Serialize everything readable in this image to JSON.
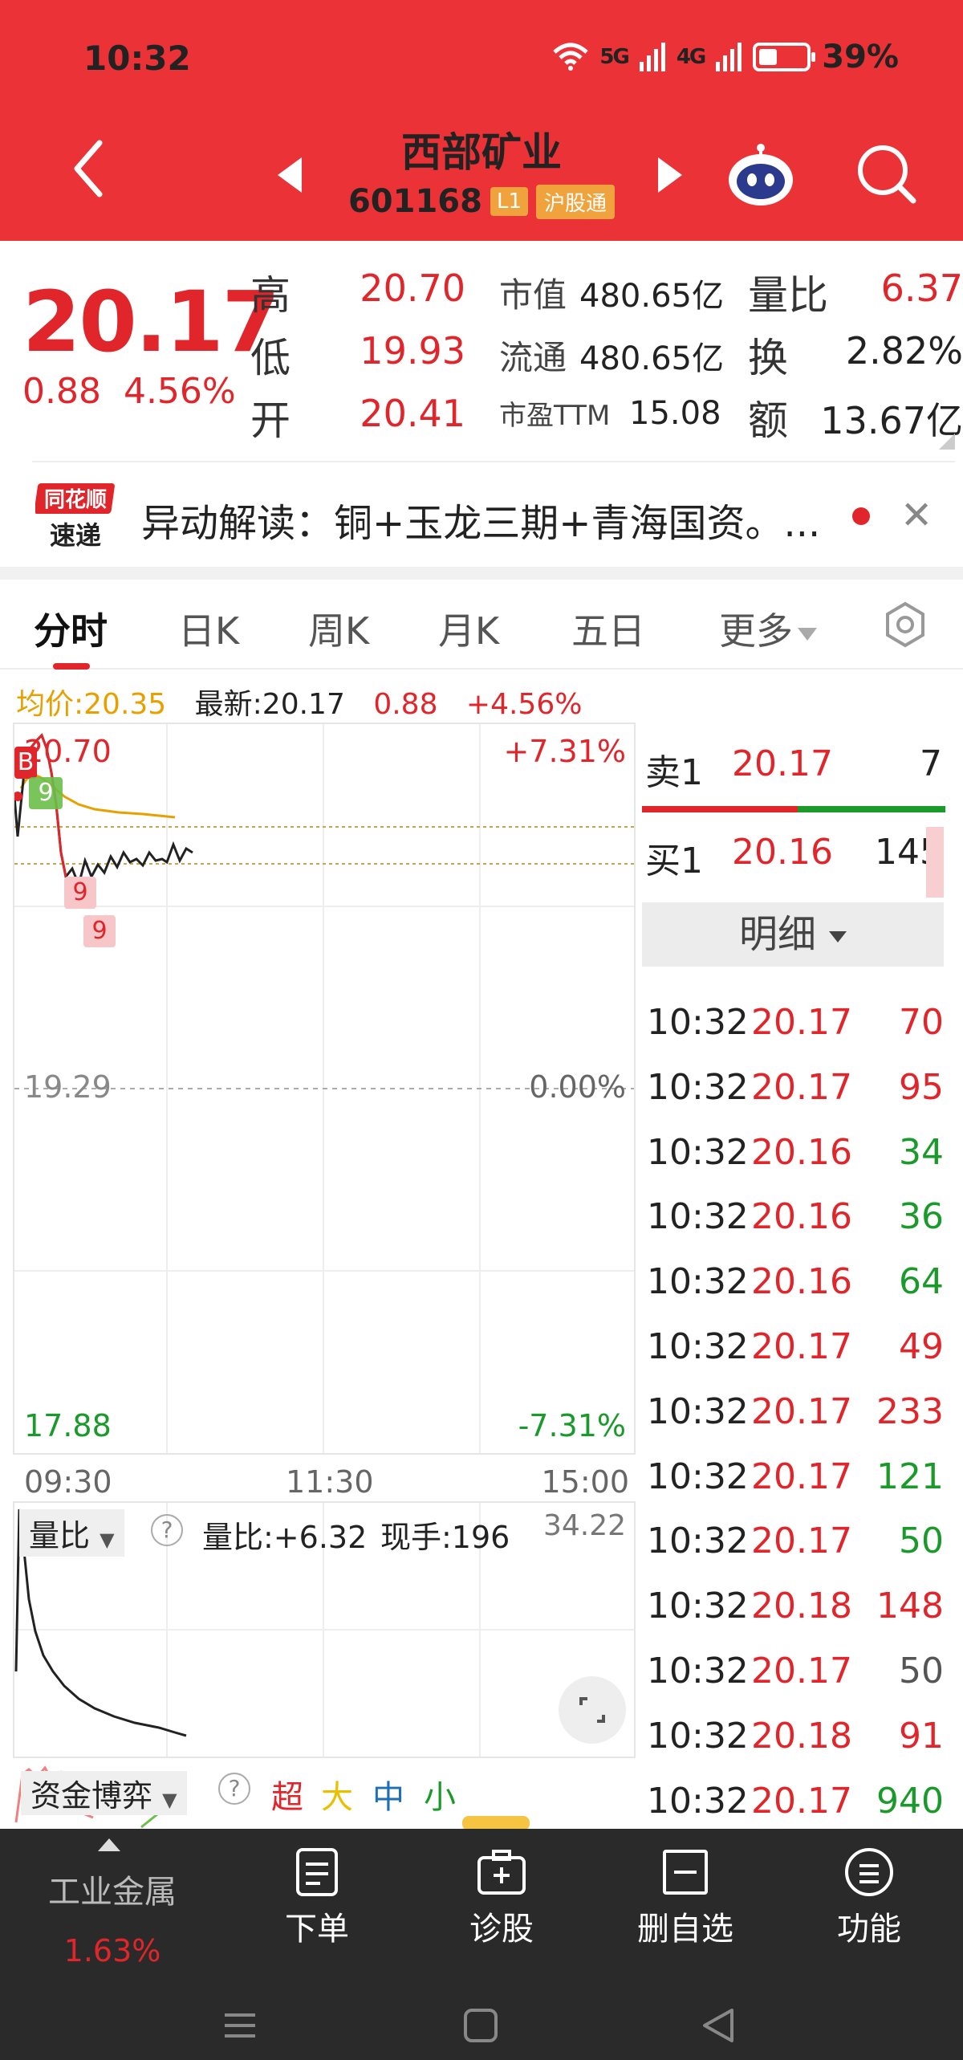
{
  "status_bar": {
    "time": "10:32",
    "signal1": "5G",
    "signal2": "4G",
    "battery": "39%"
  },
  "header": {
    "title": "西部矿业",
    "code": "601168",
    "level_tag": "L1",
    "connect_tag": "沪股通"
  },
  "quote": {
    "price": "20.17",
    "change": "0.88",
    "change_pct": "4.56%",
    "high_label": "高",
    "high": "20.70",
    "low_label": "低",
    "low": "19.93",
    "open_label": "开",
    "open": "20.41",
    "mcap_label": "市值",
    "mcap": "480.65亿",
    "float_label": "流通",
    "float": "480.65亿",
    "pe_label": "市盈TTM",
    "pe": "15.08",
    "vr_label": "量比",
    "vr": "6.37",
    "turnover_label": "换",
    "turnover": "2.82%",
    "amount_label": "额",
    "amount": "13.67亿"
  },
  "news": {
    "logo_line1": "同花顺",
    "logo_line2": "速递",
    "text": "异动解读：铜+玉龙三期+青海国资。..."
  },
  "tabs": [
    "分时",
    "日K",
    "周K",
    "月K",
    "五日",
    "更多"
  ],
  "info_line": {
    "avg": "均价:20.35",
    "latest": "最新:20.17",
    "chg": "0.88",
    "pct": "+4.56%"
  },
  "chart": {
    "top_price": "20.70",
    "top_pct": "+7.31%",
    "mid_price": "19.29",
    "mid_pct": "0.00%",
    "bottom_price": "17.88",
    "bottom_pct": "-7.31%",
    "markers": [
      "B",
      "9",
      "9",
      "9"
    ],
    "times": [
      "09:30",
      "11:30",
      "15:00"
    ]
  },
  "volume_panel": {
    "selector": "量比",
    "help": "?",
    "ratio": "量比:+6.32",
    "hand": "现手:196",
    "max": "34.22"
  },
  "fund_panel": {
    "selector": "资金博弈",
    "help": "?",
    "super": "超",
    "big": "大",
    "mid": "中",
    "small": "小"
  },
  "book": {
    "sell1": {
      "label": "卖1",
      "price": "20.17",
      "vol": "7"
    },
    "buy1": {
      "label": "买1",
      "price": "20.16",
      "vol": "145"
    },
    "detail_label": "明细"
  },
  "ticks": [
    {
      "time": "10:32",
      "price": "20.17",
      "vol": "70",
      "color": "red"
    },
    {
      "time": "10:32",
      "price": "20.17",
      "vol": "95",
      "color": "red"
    },
    {
      "time": "10:32",
      "price": "20.16",
      "vol": "34",
      "color": "green"
    },
    {
      "time": "10:32",
      "price": "20.16",
      "vol": "36",
      "color": "green"
    },
    {
      "time": "10:32",
      "price": "20.16",
      "vol": "64",
      "color": "green"
    },
    {
      "time": "10:32",
      "price": "20.17",
      "vol": "49",
      "color": "red"
    },
    {
      "time": "10:32",
      "price": "20.17",
      "vol": "233",
      "color": "red"
    },
    {
      "time": "10:32",
      "price": "20.17",
      "vol": "121",
      "color": "green"
    },
    {
      "time": "10:32",
      "price": "20.17",
      "vol": "50",
      "color": "green"
    },
    {
      "time": "10:32",
      "price": "20.18",
      "vol": "148",
      "color": "red"
    },
    {
      "time": "10:32",
      "price": "20.17",
      "vol": "50",
      "color": "gray"
    },
    {
      "time": "10:32",
      "price": "20.18",
      "vol": "91",
      "color": "red"
    },
    {
      "time": "10:32",
      "price": "20.17",
      "vol": "940",
      "color": "green"
    }
  ],
  "bottom_nav": {
    "sector_name": "工业金属",
    "sector_pct": "1.63%",
    "items": [
      "下单",
      "诊股",
      "删自选",
      "功能"
    ]
  },
  "colors": {
    "header_red": "#eb3236",
    "up_red": "#e0252b",
    "down_green": "#1a9a2a",
    "avg_orange": "#e8a000",
    "nav_dark": "#2a2a2a"
  }
}
